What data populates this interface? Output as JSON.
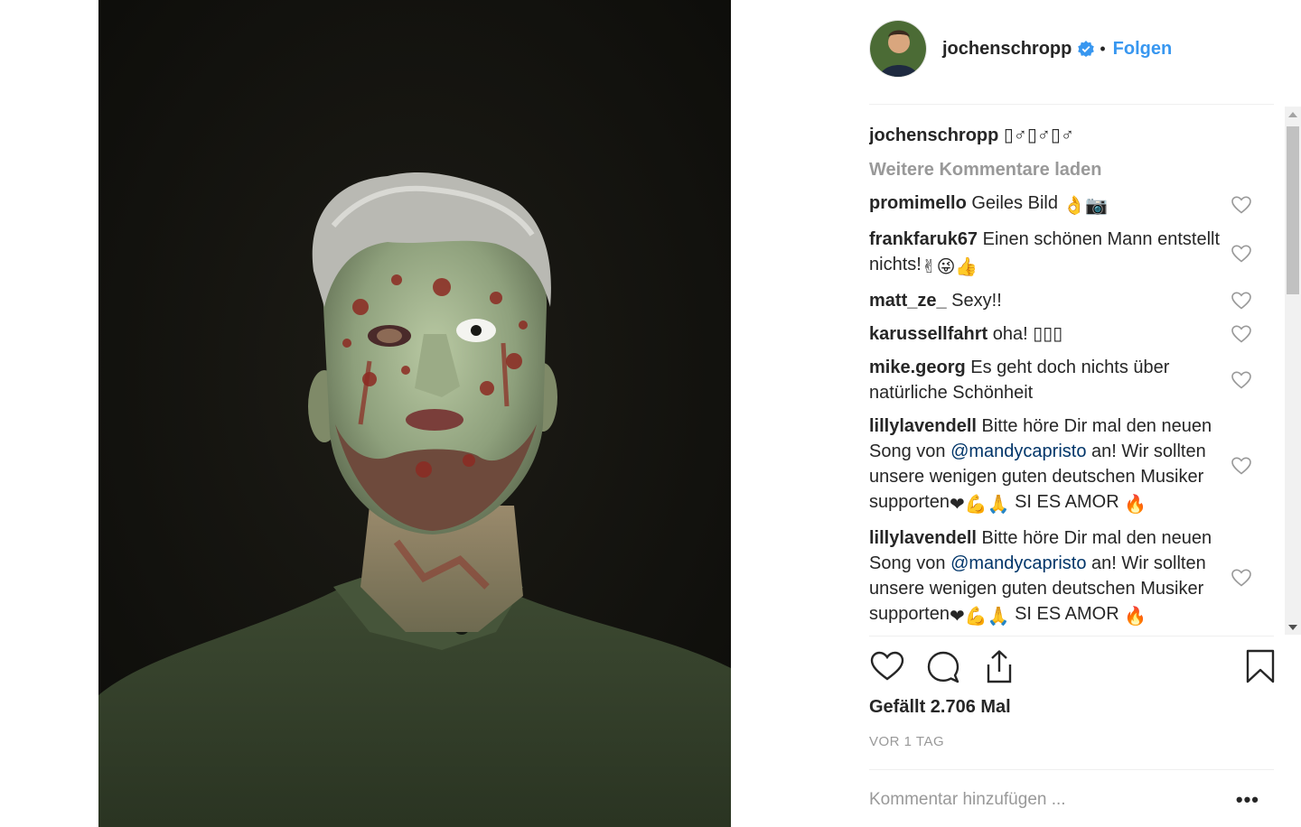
{
  "post": {
    "username": "jochenschropp",
    "follow_label": "Folgen",
    "dot": "•",
    "verified_color": "#3897f0",
    "accent": "#3897f0",
    "caption_text": "▯♂▯♂▯♂",
    "load_more": "Weitere Kommentare laden",
    "likes": "Gefällt 2.706 Mal",
    "timestamp": "VOR 1 TAG",
    "comment_placeholder": "Kommentar hinzufügen ...",
    "more_options": "•••"
  },
  "comments": [
    {
      "user": "promimello",
      "text": "Geiles Bild",
      "emojis": "👌📷"
    },
    {
      "user": "frankfaruk67",
      "text": "Einen schönen Mann entstellt nichts!",
      "emojis": "✌😜👍"
    },
    {
      "user": "matt_ze_",
      "text": "Sexy!!"
    },
    {
      "user": "karussellfahrt",
      "text": "oha! ▯▯▯"
    },
    {
      "user": "mike.georg",
      "text": "Es geht doch nichts über natürliche Schönheit"
    },
    {
      "user": "lillylavendell",
      "text_before": "Bitte höre Dir mal den neuen Song von",
      "mention": "@mandycapristo",
      "text_after": "an! Wir sollten unsere wenigen guten deutschen Musiker supporten",
      "emojis": "❤💪🙏",
      "tail": "SI ES AMOR",
      "tail_emoji": "🔥"
    },
    {
      "user": "lillylavendell",
      "text_before": "Bitte höre Dir mal den neuen Song von",
      "mention": "@mandycapristo",
      "text_after": "an! Wir sollten unsere wenigen guten deutschen Musiker supporten",
      "emojis": "❤💪🙏",
      "tail": "SI ES AMOR",
      "tail_emoji": "🔥"
    }
  ],
  "icons": {
    "like": "heart-icon",
    "comment": "comment-icon",
    "share": "share-icon",
    "save": "bookmark-icon"
  }
}
